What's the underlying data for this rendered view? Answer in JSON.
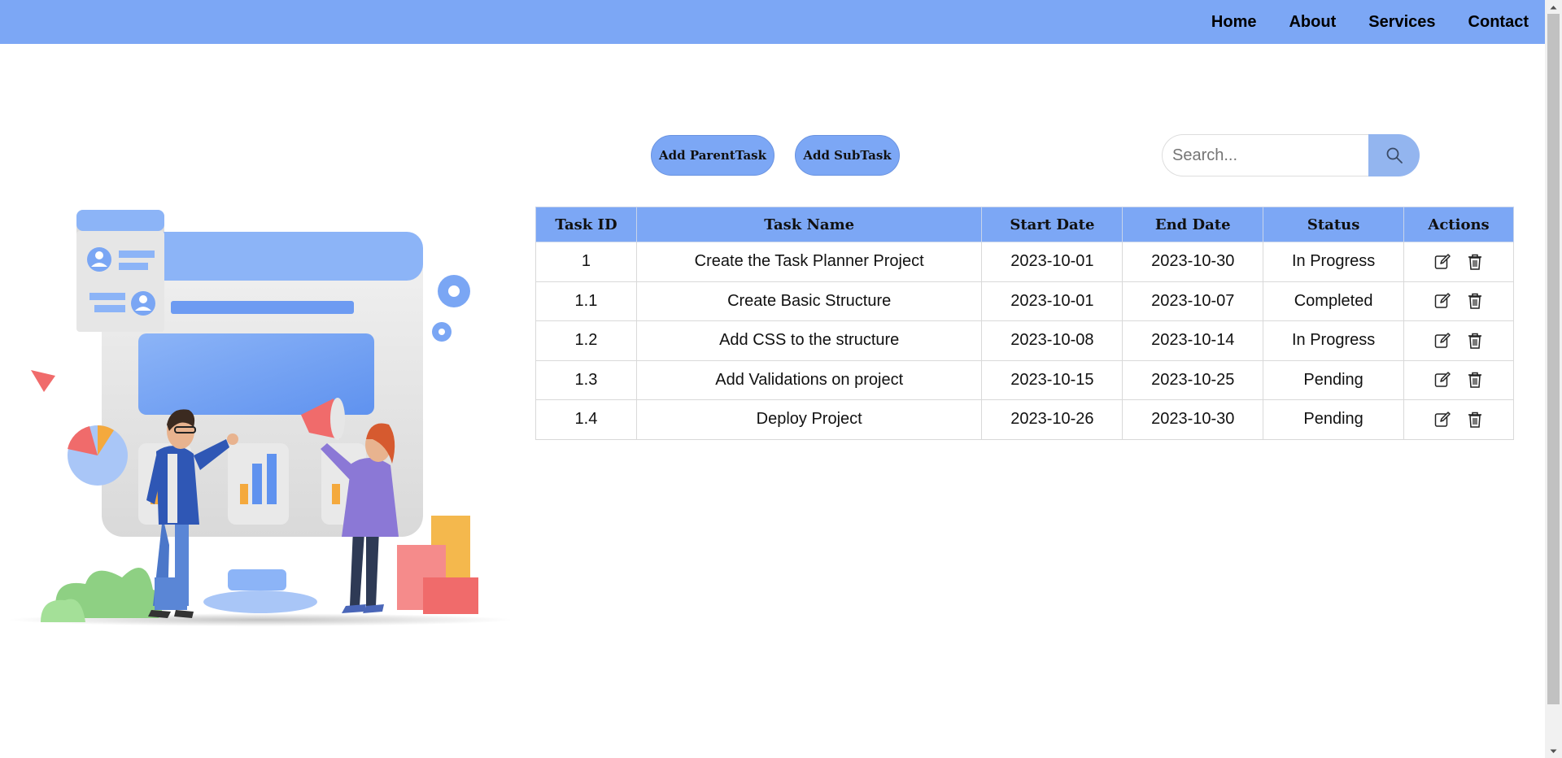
{
  "nav": {
    "links": [
      {
        "label": "Home"
      },
      {
        "label": "About"
      },
      {
        "label": "Services"
      },
      {
        "label": "Contact"
      }
    ]
  },
  "toolbar": {
    "add_parent_label": "Add ParentTask",
    "add_sub_label": "Add SubTask",
    "search_placeholder": "Search...",
    "search_value": "",
    "search_icon": "search-icon"
  },
  "table": {
    "headers": [
      "Task ID",
      "Task Name",
      "Start Date",
      "End Date",
      "Status",
      "Actions"
    ],
    "rows": [
      {
        "id": "1",
        "name": "Create the Task Planner Project",
        "start": "2023-10-01",
        "end": "2023-10-30",
        "status": "In Progress"
      },
      {
        "id": "1.1",
        "name": "Create Basic Structure",
        "start": "2023-10-01",
        "end": "2023-10-07",
        "status": "Completed"
      },
      {
        "id": "1.2",
        "name": "Add CSS to the structure",
        "start": "2023-10-08",
        "end": "2023-10-14",
        "status": "In Progress"
      },
      {
        "id": "1.3",
        "name": "Add Validations on project",
        "start": "2023-10-15",
        "end": "2023-10-25",
        "status": "Pending"
      },
      {
        "id": "1.4",
        "name": "Deploy Project",
        "start": "2023-10-26",
        "end": "2023-10-30",
        "status": "Pending"
      }
    ],
    "action_icons": [
      "edit-icon",
      "trash-icon"
    ]
  },
  "colors": {
    "accent": "#7ca7f5",
    "in_progress": "#7a7a7a",
    "completed": "#1a8a1a",
    "pending": "#e01e1e"
  },
  "illustration": {
    "description_icon": "team-presentation-illustration"
  }
}
